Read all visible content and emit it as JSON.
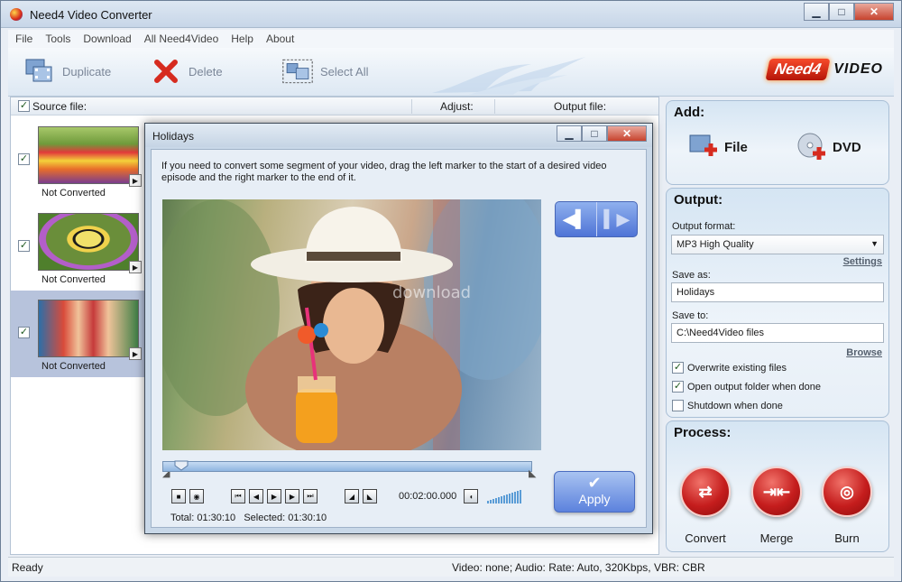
{
  "window": {
    "title": "Need4 Video Converter"
  },
  "menu": [
    "File",
    "Tools",
    "Download",
    "All Need4Video",
    "Help",
    "About"
  ],
  "toolbar": {
    "duplicate_label": "Duplicate",
    "delete_label": "Delete",
    "select_all_label": "Select All",
    "logo_need4": "Need4",
    "logo_video": "VIDEO"
  },
  "file_list": {
    "header_source": "Source file:",
    "header_adjust": "Adjust:",
    "header_output": "Output file:",
    "source_checked": true,
    "items": [
      {
        "status": "Not Converted",
        "checked": true,
        "thumbnail": "tulips"
      },
      {
        "status": "Not Converted",
        "checked": true,
        "thumbnail": "butterfly"
      },
      {
        "status": "Not Converted",
        "checked": true,
        "thumbnail": "children"
      }
    ]
  },
  "dialog": {
    "title": "Holidays",
    "instructions": "If you need to convert some segment of your video, drag the left marker to the start of a desired video episode and the right marker to the end of it.",
    "current_time": "00:02:00.000",
    "total_label": "Total: 01:30:10",
    "selected_label": "Selected: 01:30:10",
    "apply_label": "Apply",
    "watermark": "download"
  },
  "add_panel": {
    "heading": "Add:",
    "file_label": "File",
    "dvd_label": "DVD"
  },
  "output_panel": {
    "heading": "Output:",
    "format_label": "Output format:",
    "format_value": "MP3 High Quality",
    "settings_link": "Settings",
    "save_as_label": "Save as:",
    "save_as_value": "Holidays",
    "save_to_label": "Save to:",
    "save_to_value": "C:\\Need4Video files",
    "browse_link": "Browse",
    "overwrite_label": "Overwrite existing files",
    "overwrite_checked": true,
    "open_folder_label": "Open output folder when done",
    "open_folder_checked": true,
    "shutdown_label": "Shutdown when done",
    "shutdown_checked": false
  },
  "process_panel": {
    "heading": "Process:",
    "convert_label": "Convert",
    "merge_label": "Merge",
    "burn_label": "Burn"
  },
  "status_bar": {
    "left": "Ready",
    "right": "Video: none; Audio: Rate: Auto, 320Kbps, VBR: CBR"
  },
  "colors": {
    "accent_red": "#c51d1d",
    "accent_blue": "#5c82dd",
    "selection": "#b7c3dc"
  }
}
